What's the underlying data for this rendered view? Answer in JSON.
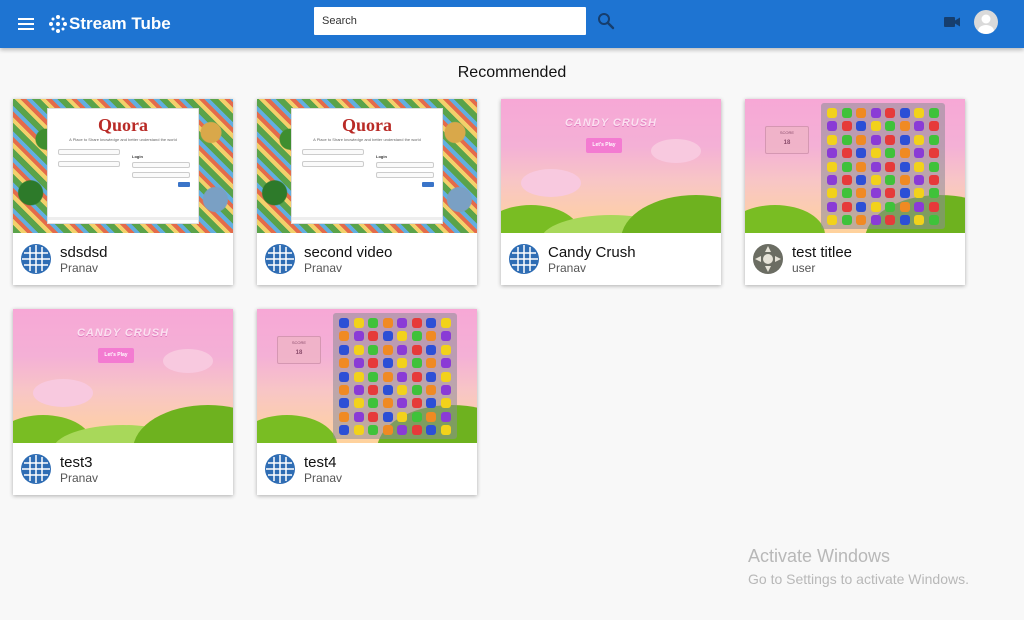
{
  "appbar": {
    "brand": "Stream Tube",
    "search_placeholder": "Search",
    "search_value": "",
    "icons": [
      "menu-icon",
      "logo-icon",
      "search-icon",
      "video-camera-icon",
      "account-circle-icon"
    ]
  },
  "main": {
    "section_title": "Recommended",
    "videos": [
      {
        "title": "sdsdsd",
        "author": "Pranav",
        "thumbnail": "quora-signin"
      },
      {
        "title": "second video",
        "author": "Pranav",
        "thumbnail": "quora-signin"
      },
      {
        "title": "Candy Crush",
        "author": "Pranav",
        "thumbnail": "candy-menu"
      },
      {
        "title": "test titlee",
        "author": "user",
        "thumbnail": "candy-board"
      },
      {
        "title": "test3",
        "author": "Pranav",
        "thumbnail": "candy-menu"
      },
      {
        "title": "test4",
        "author": "Pranav",
        "thumbnail": "candy-board"
      }
    ]
  },
  "thumbnails": {
    "quora": {
      "logo": "Quora",
      "tagline": "A Place to Share knowledge and better understand the world",
      "login": "Login"
    },
    "candy_menu": {
      "title": "CANDY CRUSH",
      "play": "Let's Play"
    },
    "candy_board": {
      "score_label": "SCORE",
      "score_value": "18"
    }
  },
  "watermark": {
    "line1": "Activate Windows",
    "line2": "Go to Settings to activate Windows."
  },
  "colors": {
    "appbar": "#1e74d2",
    "background": "#f8f8f8"
  }
}
